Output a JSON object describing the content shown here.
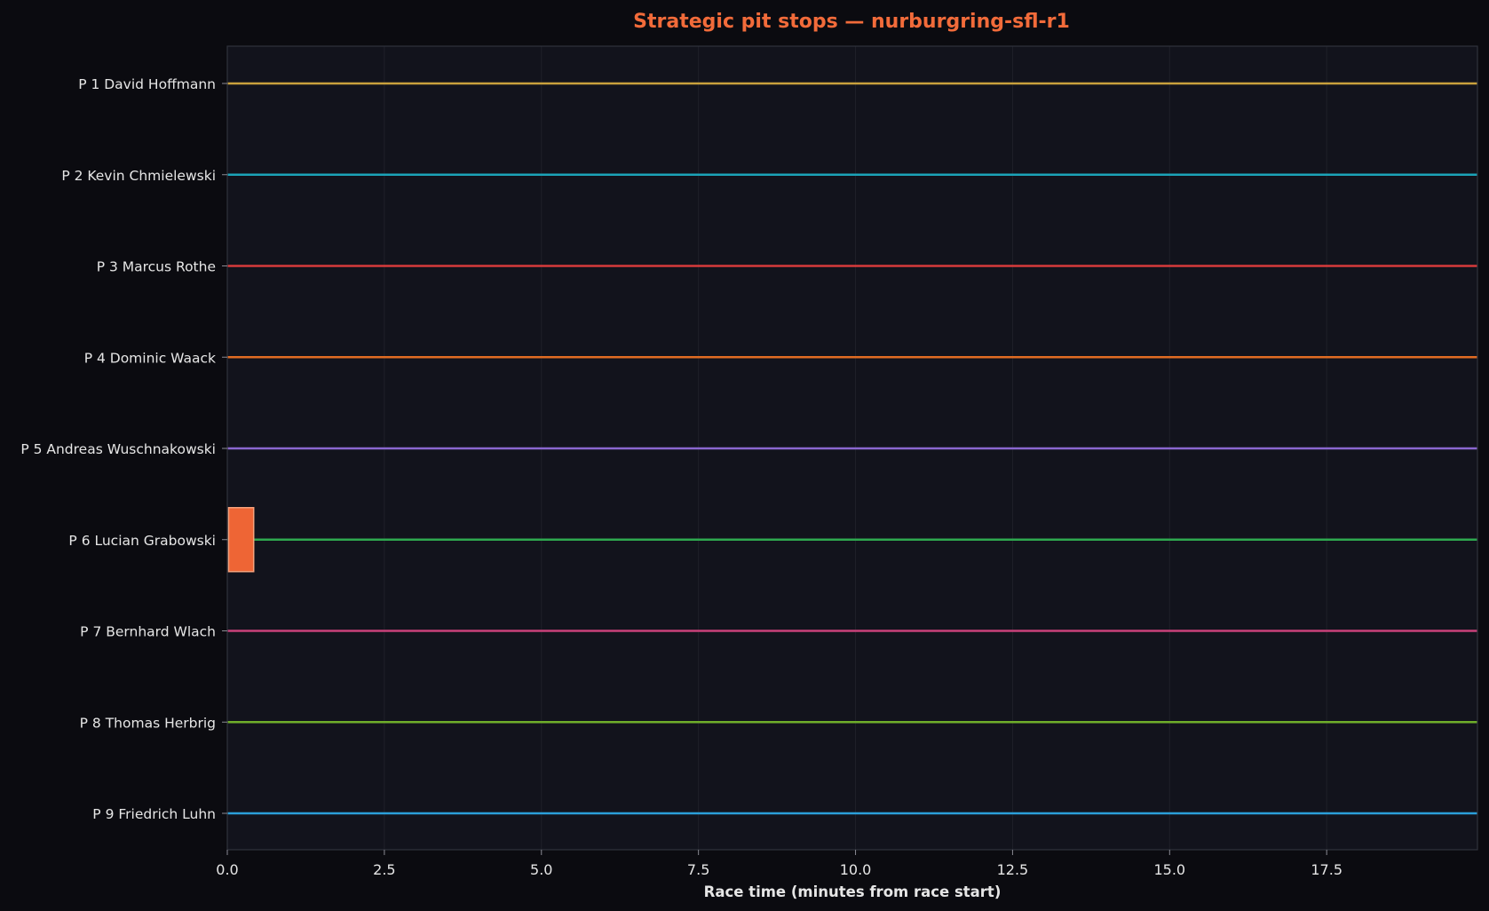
{
  "chart_data": {
    "type": "gantt",
    "title": "Strategic pit stops — nurburgring-sfl-r1",
    "xlabel": "Race time (minutes from race start)",
    "ylabel": "",
    "xlim": [
      0,
      19.9
    ],
    "x_ticks": [
      "0.0",
      "2.5",
      "5.0",
      "7.5",
      "10.0",
      "12.5",
      "15.0",
      "17.5"
    ],
    "grid": true,
    "series": [
      {
        "label": "P 1 David Hoffmann",
        "color": "#c9a13d",
        "stops": []
      },
      {
        "label": "P 2 Kevin Chmielewski",
        "color": "#1ba3b8",
        "stops": []
      },
      {
        "label": "P 3 Marcus Rothe",
        "color": "#d63b3b",
        "stops": []
      },
      {
        "label": "P 4 Dominic Waack",
        "color": "#e06b22",
        "stops": []
      },
      {
        "label": "P 5 Andreas Wuschnakowski",
        "color": "#8a66cf",
        "stops": []
      },
      {
        "label": "P 6 Lucian Grabowski",
        "color": "#2ea84f",
        "stops": [
          {
            "start": 0.02,
            "end": 0.42
          }
        ]
      },
      {
        "label": "P 7 Bernhard Wlach",
        "color": "#c9417a",
        "stops": []
      },
      {
        "label": "P 8 Thomas Herbrig",
        "color": "#6fad2a",
        "stops": []
      },
      {
        "label": "P 9 Friedrich Luhn",
        "color": "#2b9fd9",
        "stops": []
      }
    ]
  },
  "colors": {
    "page_bg": "#0b0b10",
    "plot_bg": "#12131c",
    "title": "#f26b3a",
    "stop_fill": "#ee6535",
    "stop_edge": "#f7a27c",
    "grid": "#1f2029",
    "spine": "#30323c"
  }
}
